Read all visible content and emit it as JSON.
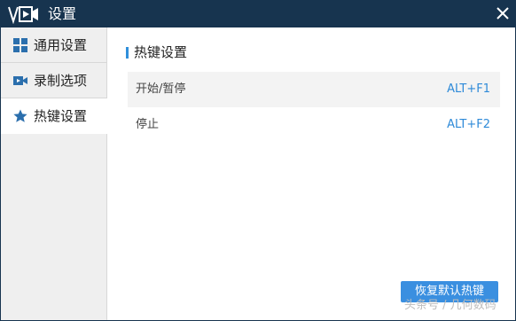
{
  "window": {
    "title": "设置",
    "title_bar_color": "#17344f",
    "accent_color": "#2f8fdb"
  },
  "sidebar": {
    "items": [
      {
        "label": "通用设置",
        "icon": "grid-icon",
        "selected": false
      },
      {
        "label": "录制选项",
        "icon": "video-camera-icon",
        "selected": false
      },
      {
        "label": "热键设置",
        "icon": "star-icon",
        "selected": true
      }
    ]
  },
  "main": {
    "section_title": "热键设置",
    "hotkeys": [
      {
        "name": "开始/暂停",
        "key": "ALT+F1"
      },
      {
        "name": "停止",
        "key": "ALT+F2"
      }
    ],
    "restore_button": "恢复默认热键"
  },
  "watermark": "头条号 / 几何数码"
}
